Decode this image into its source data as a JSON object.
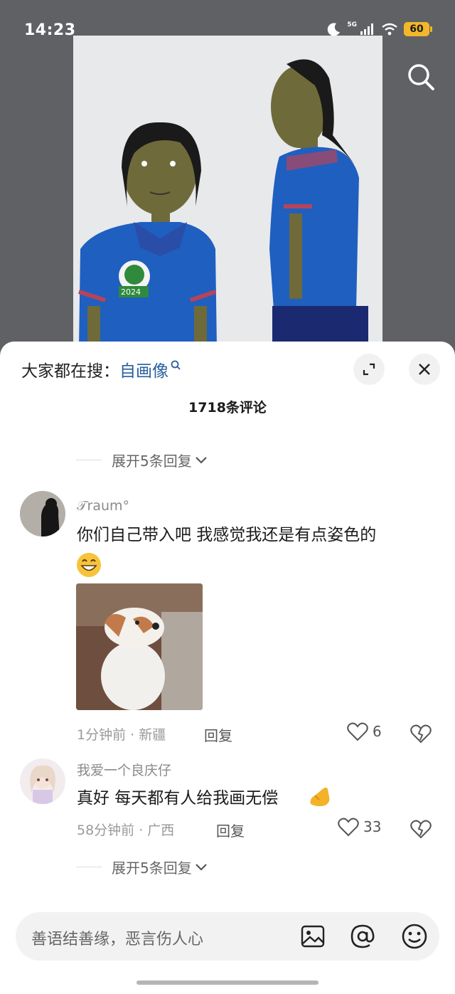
{
  "status_bar": {
    "time": "14:23",
    "network": "5G",
    "battery": "60"
  },
  "artwork": {
    "badge_text": "2024"
  },
  "sheet": {
    "trend_prefix": "大家都在搜：",
    "trend_keyword": "自画像",
    "comment_count": "1718条评论",
    "expand_replies_top": "展开5条回复",
    "expand_replies_bottom": "展开5条回复"
  },
  "comments": [
    {
      "username": "𝒯raum°",
      "text_line1": "你们自己带入吧 我感觉我还是有点姿色的",
      "emoji": "grinning-face",
      "time_location": "1分钟前 · 新疆",
      "reply_label": "回复",
      "likes": "6"
    },
    {
      "username": "我爱一个良庆仔",
      "text": "真好 每天都有人给我画无偿",
      "emoji": "hand-gesture",
      "time_location": "58分钟前 · 广西",
      "reply_label": "回复",
      "likes": "33"
    }
  ],
  "input": {
    "placeholder": "善语结善缘，恶言伤人心"
  },
  "colors": {
    "keyword": "#2a5f9e",
    "battery": "#f2b72a",
    "sheet_bg": "#ffffff"
  }
}
